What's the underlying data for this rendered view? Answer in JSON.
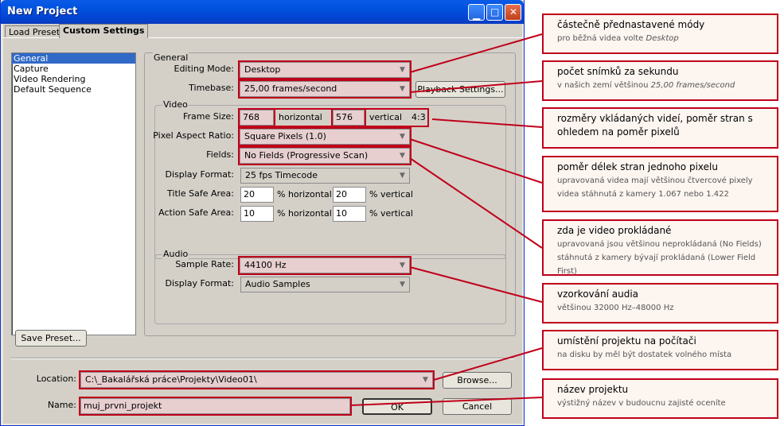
{
  "window": {
    "title": "New Project",
    "tabs": [
      "Load Preset",
      "Custom Settings"
    ]
  },
  "nav": {
    "items": [
      "General",
      "Capture",
      "Video Rendering",
      "Default Sequence"
    ]
  },
  "general": {
    "group_label": "General",
    "editing_mode_label": "Editing Mode:",
    "editing_mode_value": "Desktop",
    "timebase_label": "Timebase:",
    "timebase_value": "25,00 frames/second",
    "playback_settings_button": "Playback Settings..."
  },
  "video": {
    "group_label": "Video",
    "frame_size_label": "Frame Size:",
    "frame_width": "768",
    "horizontal_label": "horizontal",
    "frame_height": "576",
    "vertical_label": "vertical",
    "aspect_ratio": "4:3",
    "pixel_aspect_label": "Pixel Aspect Ratio:",
    "pixel_aspect_value": "Square Pixels (1.0)",
    "fields_label": "Fields:",
    "fields_value": "No Fields (Progressive Scan)",
    "display_format_label": "Display Format:",
    "display_format_value": "25 fps Timecode",
    "title_safe_label": "Title Safe Area:",
    "title_safe_h": "20",
    "title_safe_v": "20",
    "action_safe_label": "Action Safe Area:",
    "action_safe_h": "10",
    "action_safe_v": "10",
    "pct_horizontal": "% horizontal",
    "pct_vertical": "% vertical"
  },
  "audio": {
    "group_label": "Audio",
    "sample_rate_label": "Sample Rate:",
    "sample_rate_value": "44100 Hz",
    "display_format_label": "Display Format:",
    "display_format_value": "Audio Samples"
  },
  "footer": {
    "save_preset_button": "Save Preset...",
    "location_label": "Location:",
    "location_value": "C:\\_Bakalářská práce\\Projekty\\Video01\\",
    "browse_button": "Browse...",
    "name_label": "Name:",
    "name_value": "muj_prvni_projekt",
    "ok_button": "OK",
    "cancel_button": "Cancel"
  },
  "annotations": [
    {
      "title": "částečně přednastavené módy",
      "sub": "pro běžná videa volte ",
      "sub_em": "Desktop"
    },
    {
      "title": "počet snímků za sekundu",
      "sub": "v našich zemí většinou ",
      "sub_em": "25,00 frames/second"
    },
    {
      "title": "rozměry vkládaných videí, poměr stran s ohledem na poměr pixelů"
    },
    {
      "title": "poměr délek stran jednoho pixelu",
      "sub": "upravovaná videa mají většinou čtvercové pixely",
      "sub2": "videa stáhnutá z kamery 1.067 nebo 1.422"
    },
    {
      "title": "zda je video prokládané",
      "sub": "upravovaná jsou většinou neprokládaná (No Fields)",
      "sub2": "stáhnutá z kamery bývají prokládaná (Lower Field First)"
    },
    {
      "title": "vzorkování audia",
      "sub": "většinou 32000 Hz–48000 Hz"
    },
    {
      "title": "umístění projektu na počítači",
      "sub": "na disku by měl být dostatek volného místa"
    },
    {
      "title": "název projektu",
      "sub": "výstižný název v budoucnu zajisté oceníte"
    }
  ],
  "colors": {
    "highlight": "#c0001a",
    "titlebar": "#0254e0",
    "callout_bg": "#fdf5f0"
  }
}
